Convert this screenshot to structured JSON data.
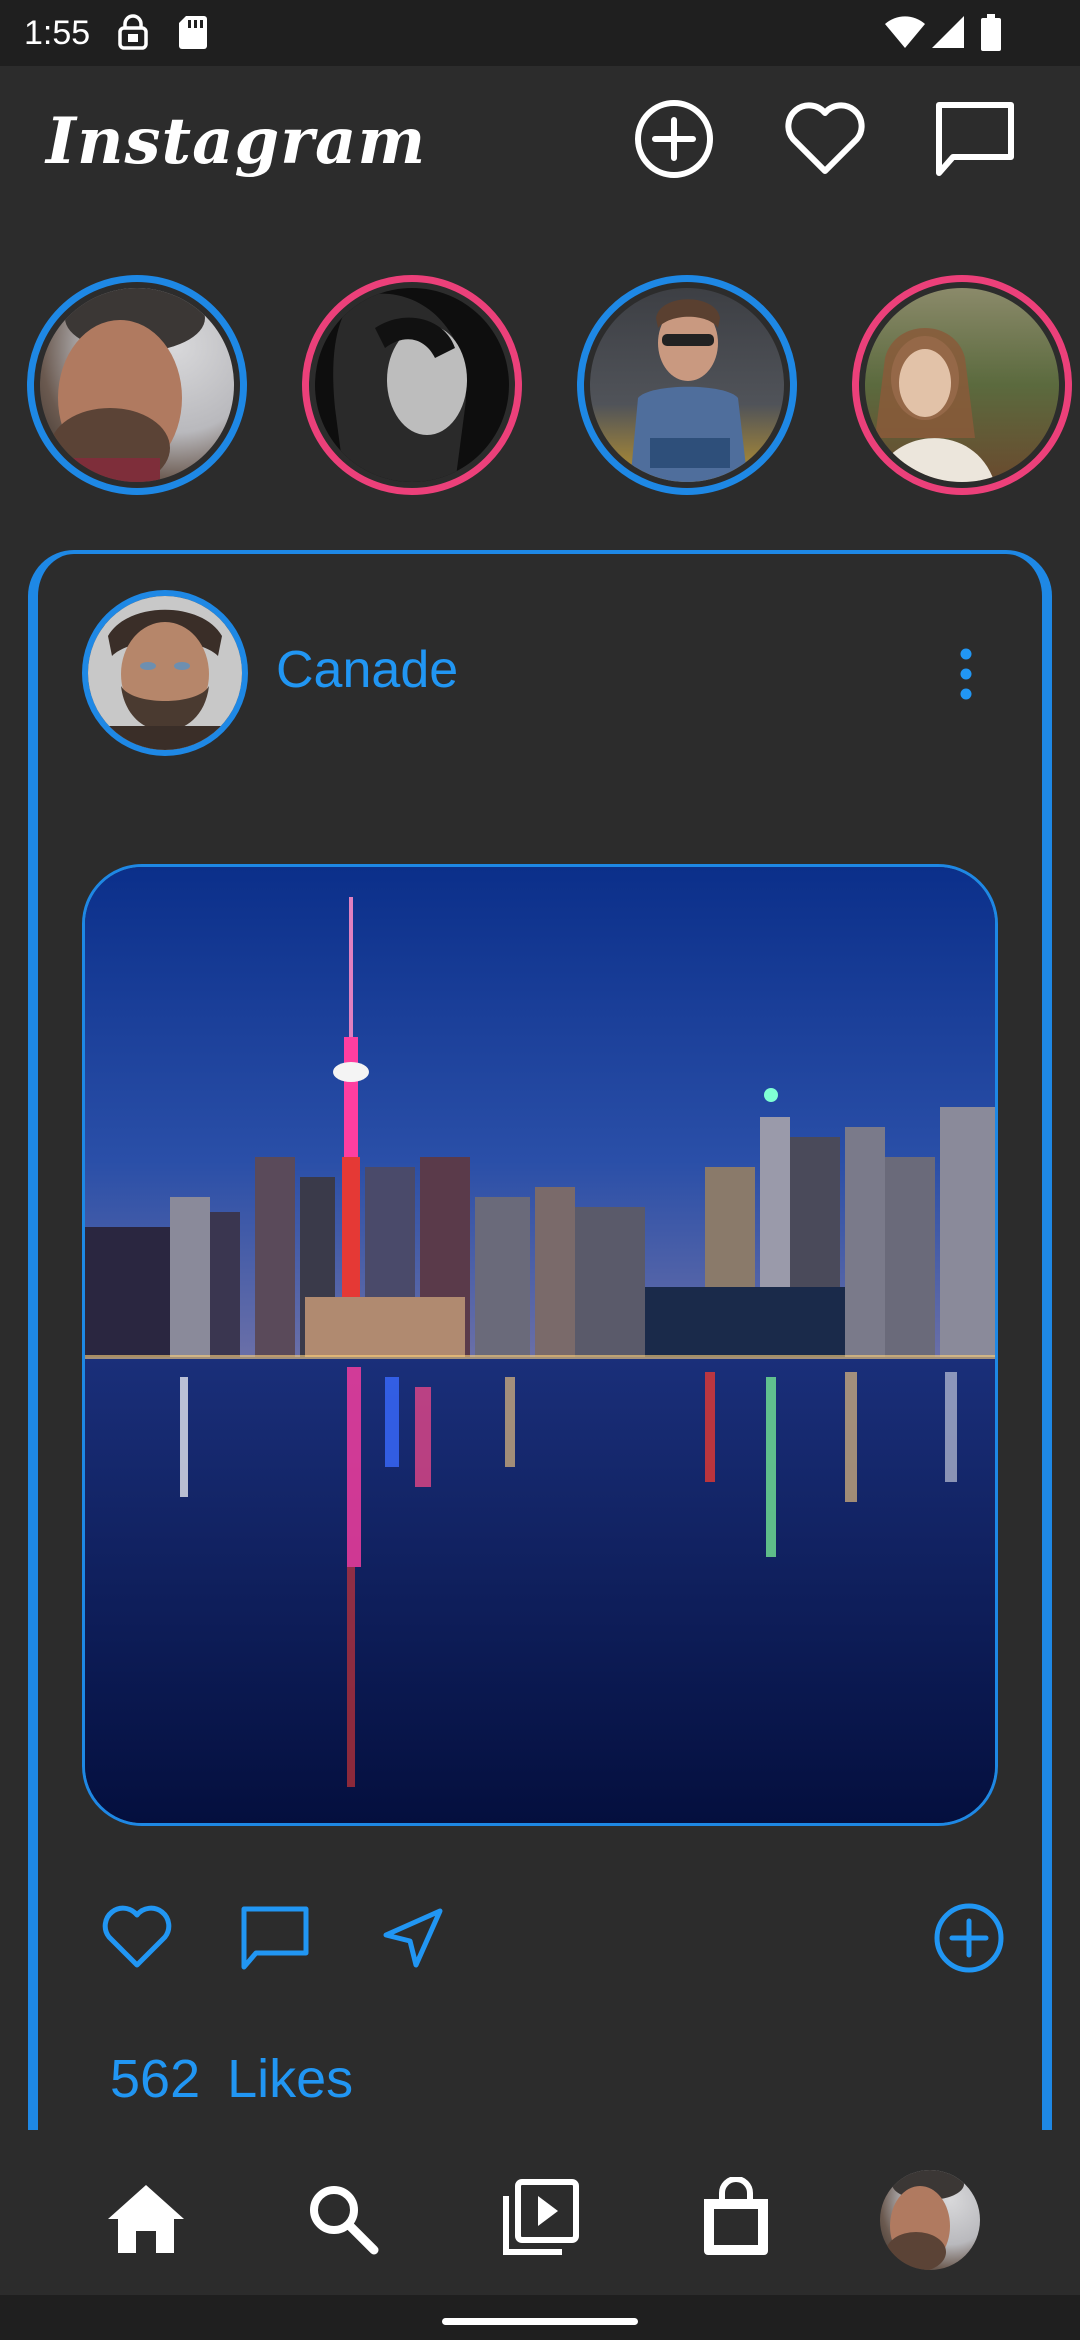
{
  "status_bar": {
    "time": "1:55",
    "icons": [
      "sim-lock-icon",
      "sd-card-icon",
      "wifi-icon",
      "signal-icon",
      "battery-icon"
    ]
  },
  "header": {
    "title": "Instagram",
    "actions": [
      "add-post-icon",
      "heart-icon",
      "messages-icon"
    ]
  },
  "stories": [
    {
      "ring": "#1e88e5"
    },
    {
      "ring": "#ec407a"
    },
    {
      "ring": "#1e88e5"
    },
    {
      "ring": "#ec407a"
    }
  ],
  "post": {
    "author": "Canade",
    "likes_count": "562",
    "likes_label": "Likes",
    "actions": [
      "like-icon",
      "comment-icon",
      "share-icon",
      "add-icon"
    ]
  },
  "bottom_nav": {
    "items": [
      "home-icon",
      "search-icon",
      "reels-icon",
      "shop-icon",
      "profile-avatar"
    ]
  },
  "colors": {
    "accent": "#1e88e5",
    "story_pink": "#ec407a",
    "background": "#2c2c2c",
    "text_accent": "#2196f3"
  }
}
